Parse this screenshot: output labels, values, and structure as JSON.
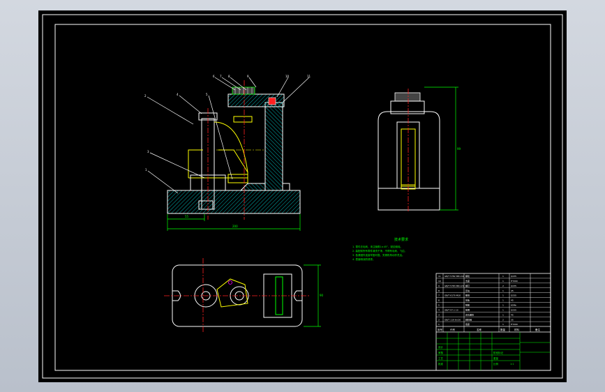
{
  "drawing": {
    "balloons": [
      "1",
      "2",
      "3",
      "4",
      "5",
      "6",
      "7",
      "8",
      "9",
      "10",
      "11"
    ],
    "dims": {
      "left_offset": "55",
      "base_width": "200",
      "side_height": "99",
      "plan_height": "90"
    },
    "notes": {
      "title": "技术要求",
      "lines": [
        "1. 零件去毛刺，未注倒角1×45°，锐边倒钝。",
        "2. 装配前所有零件清洗干净，不得有毛刺、飞边。",
        "3. 各紧固件连接牢固可靠，夹紧机构动作灵活。",
        "4. 表面喷涂防锈漆。"
      ]
    },
    "colors": {
      "sheet": "#000000",
      "border": "#ffffff",
      "dims": "#00ff00",
      "hatch": "#00c8c8",
      "centerline": "#ff2020",
      "part": "#ffff00",
      "magenta": "#ff00ff"
    }
  },
  "title_block": {
    "parts_rows": [
      {
        "no": "11",
        "code": "GB/T 5782 M8×40",
        "name": "螺栓",
        "qty": "1",
        "mat": "Q235"
      },
      {
        "no": "10",
        "code": "",
        "name": "支座",
        "qty": "1",
        "mat": "HT200"
      },
      {
        "no": "9",
        "code": "GB/T 5783 M6×20",
        "name": "螺钉",
        "qty": "2",
        "mat": "Q235"
      },
      {
        "no": "8",
        "code": "",
        "name": "压块",
        "qty": "1",
        "mat": "45"
      },
      {
        "no": "7",
        "code": "GB/T 6170 M10",
        "name": "螺母",
        "qty": "1",
        "mat": "Q235"
      },
      {
        "no": "6",
        "code": "",
        "name": "压板",
        "qty": "1",
        "mat": "45"
      },
      {
        "no": "5",
        "code": "",
        "name": "弹簧",
        "qty": "1",
        "mat": "65Mn"
      },
      {
        "no": "4",
        "code": "GB/T 97.1 10",
        "name": "垫圈",
        "qty": "1",
        "mat": "Q235"
      },
      {
        "no": "3",
        "code": "",
        "name": "双头螺柱",
        "qty": "1",
        "mat": "45"
      },
      {
        "no": "2",
        "code": "GB/T 119 6×20",
        "name": "圆柱销",
        "qty": "2",
        "mat": "35"
      },
      {
        "no": "1",
        "code": "",
        "name": "底座",
        "qty": "1",
        "mat": "HT200"
      }
    ],
    "header": {
      "no": "序号",
      "code": "代号",
      "name": "名称",
      "qty": "数量",
      "mat": "材料",
      "note": "备注"
    },
    "sign_row": [
      "设计",
      "审核",
      "工艺",
      "批准"
    ],
    "stage": [
      "阶段标记",
      "重量",
      "比例"
    ],
    "scale": "1:1"
  }
}
